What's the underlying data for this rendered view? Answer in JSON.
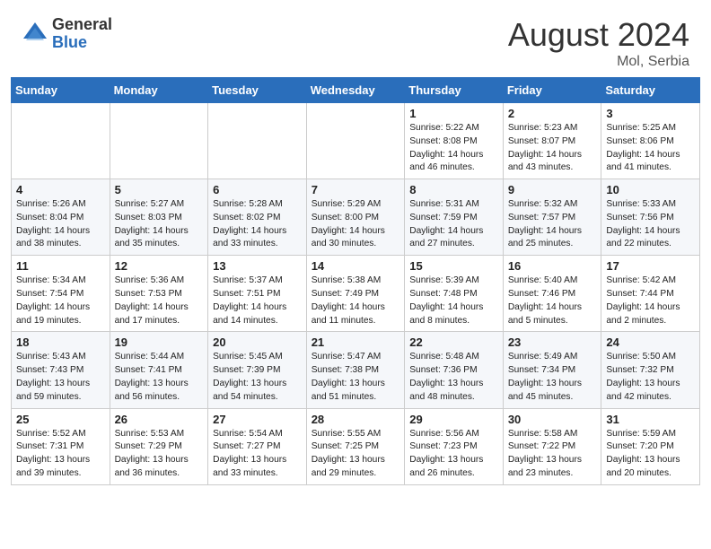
{
  "header": {
    "logo_general": "General",
    "logo_blue": "Blue",
    "month_year": "August 2024",
    "location": "Mol, Serbia"
  },
  "weekdays": [
    "Sunday",
    "Monday",
    "Tuesday",
    "Wednesday",
    "Thursday",
    "Friday",
    "Saturday"
  ],
  "weeks": [
    [
      {
        "day": "",
        "info": ""
      },
      {
        "day": "",
        "info": ""
      },
      {
        "day": "",
        "info": ""
      },
      {
        "day": "",
        "info": ""
      },
      {
        "day": "1",
        "info": "Sunrise: 5:22 AM\nSunset: 8:08 PM\nDaylight: 14 hours\nand 46 minutes."
      },
      {
        "day": "2",
        "info": "Sunrise: 5:23 AM\nSunset: 8:07 PM\nDaylight: 14 hours\nand 43 minutes."
      },
      {
        "day": "3",
        "info": "Sunrise: 5:25 AM\nSunset: 8:06 PM\nDaylight: 14 hours\nand 41 minutes."
      }
    ],
    [
      {
        "day": "4",
        "info": "Sunrise: 5:26 AM\nSunset: 8:04 PM\nDaylight: 14 hours\nand 38 minutes."
      },
      {
        "day": "5",
        "info": "Sunrise: 5:27 AM\nSunset: 8:03 PM\nDaylight: 14 hours\nand 35 minutes."
      },
      {
        "day": "6",
        "info": "Sunrise: 5:28 AM\nSunset: 8:02 PM\nDaylight: 14 hours\nand 33 minutes."
      },
      {
        "day": "7",
        "info": "Sunrise: 5:29 AM\nSunset: 8:00 PM\nDaylight: 14 hours\nand 30 minutes."
      },
      {
        "day": "8",
        "info": "Sunrise: 5:31 AM\nSunset: 7:59 PM\nDaylight: 14 hours\nand 27 minutes."
      },
      {
        "day": "9",
        "info": "Sunrise: 5:32 AM\nSunset: 7:57 PM\nDaylight: 14 hours\nand 25 minutes."
      },
      {
        "day": "10",
        "info": "Sunrise: 5:33 AM\nSunset: 7:56 PM\nDaylight: 14 hours\nand 22 minutes."
      }
    ],
    [
      {
        "day": "11",
        "info": "Sunrise: 5:34 AM\nSunset: 7:54 PM\nDaylight: 14 hours\nand 19 minutes."
      },
      {
        "day": "12",
        "info": "Sunrise: 5:36 AM\nSunset: 7:53 PM\nDaylight: 14 hours\nand 17 minutes."
      },
      {
        "day": "13",
        "info": "Sunrise: 5:37 AM\nSunset: 7:51 PM\nDaylight: 14 hours\nand 14 minutes."
      },
      {
        "day": "14",
        "info": "Sunrise: 5:38 AM\nSunset: 7:49 PM\nDaylight: 14 hours\nand 11 minutes."
      },
      {
        "day": "15",
        "info": "Sunrise: 5:39 AM\nSunset: 7:48 PM\nDaylight: 14 hours\nand 8 minutes."
      },
      {
        "day": "16",
        "info": "Sunrise: 5:40 AM\nSunset: 7:46 PM\nDaylight: 14 hours\nand 5 minutes."
      },
      {
        "day": "17",
        "info": "Sunrise: 5:42 AM\nSunset: 7:44 PM\nDaylight: 14 hours\nand 2 minutes."
      }
    ],
    [
      {
        "day": "18",
        "info": "Sunrise: 5:43 AM\nSunset: 7:43 PM\nDaylight: 13 hours\nand 59 minutes."
      },
      {
        "day": "19",
        "info": "Sunrise: 5:44 AM\nSunset: 7:41 PM\nDaylight: 13 hours\nand 56 minutes."
      },
      {
        "day": "20",
        "info": "Sunrise: 5:45 AM\nSunset: 7:39 PM\nDaylight: 13 hours\nand 54 minutes."
      },
      {
        "day": "21",
        "info": "Sunrise: 5:47 AM\nSunset: 7:38 PM\nDaylight: 13 hours\nand 51 minutes."
      },
      {
        "day": "22",
        "info": "Sunrise: 5:48 AM\nSunset: 7:36 PM\nDaylight: 13 hours\nand 48 minutes."
      },
      {
        "day": "23",
        "info": "Sunrise: 5:49 AM\nSunset: 7:34 PM\nDaylight: 13 hours\nand 45 minutes."
      },
      {
        "day": "24",
        "info": "Sunrise: 5:50 AM\nSunset: 7:32 PM\nDaylight: 13 hours\nand 42 minutes."
      }
    ],
    [
      {
        "day": "25",
        "info": "Sunrise: 5:52 AM\nSunset: 7:31 PM\nDaylight: 13 hours\nand 39 minutes."
      },
      {
        "day": "26",
        "info": "Sunrise: 5:53 AM\nSunset: 7:29 PM\nDaylight: 13 hours\nand 36 minutes."
      },
      {
        "day": "27",
        "info": "Sunrise: 5:54 AM\nSunset: 7:27 PM\nDaylight: 13 hours\nand 33 minutes."
      },
      {
        "day": "28",
        "info": "Sunrise: 5:55 AM\nSunset: 7:25 PM\nDaylight: 13 hours\nand 29 minutes."
      },
      {
        "day": "29",
        "info": "Sunrise: 5:56 AM\nSunset: 7:23 PM\nDaylight: 13 hours\nand 26 minutes."
      },
      {
        "day": "30",
        "info": "Sunrise: 5:58 AM\nSunset: 7:22 PM\nDaylight: 13 hours\nand 23 minutes."
      },
      {
        "day": "31",
        "info": "Sunrise: 5:59 AM\nSunset: 7:20 PM\nDaylight: 13 hours\nand 20 minutes."
      }
    ]
  ]
}
